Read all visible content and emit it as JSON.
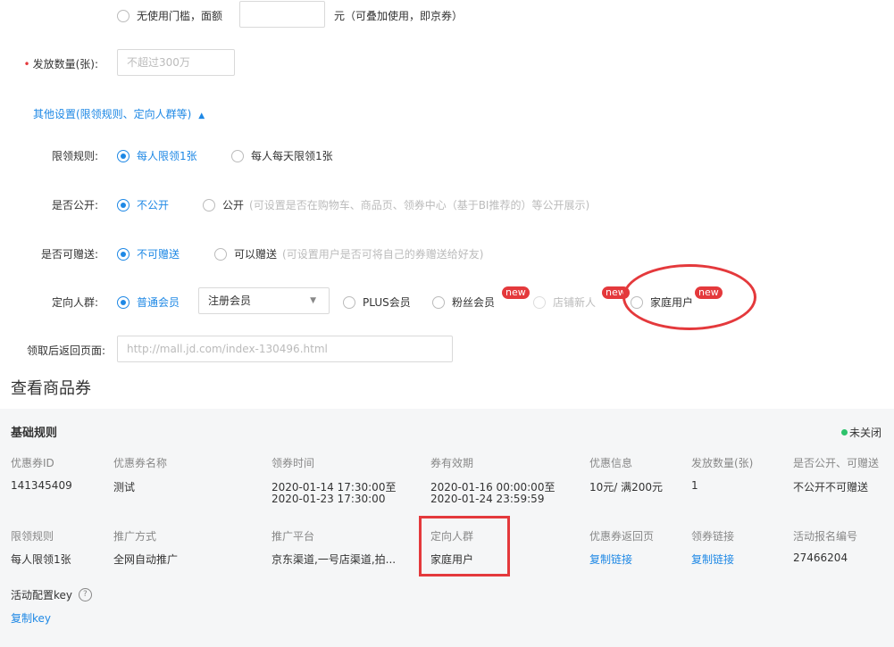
{
  "threshold": {
    "option_label": "无使用门槛，面额",
    "unit_text": "元（可叠加使用，即京券）"
  },
  "issue": {
    "label": "发放数量(张):",
    "placeholder": "不超过300万"
  },
  "other_settings": {
    "toggle_label": "其他设置(限领规则、定向人群等)",
    "toggle_icon": "caret-up-icon"
  },
  "limit_rule": {
    "label": "限领规则:",
    "options": [
      "每人限领1张",
      "每人每天限领1张"
    ]
  },
  "public": {
    "label": "是否公开:",
    "options": [
      "不公开",
      "公开"
    ],
    "hint": "(可设置是否在购物车、商品页、领券中心（基于BI推荐的）等公开展示)"
  },
  "gift": {
    "label": "是否可赠送:",
    "options": [
      "不可赠送",
      "可以赠送"
    ],
    "hint": "(可设置用户是否可将自己的券赠送给好友)"
  },
  "target": {
    "label": "定向人群:",
    "option_member": "普通会员",
    "select_value": "注册会员",
    "option_plus": "PLUS会员",
    "option_fans": "粉丝会员",
    "option_store_new": "店铺新人",
    "option_family": "家庭用户",
    "new_tag": "new"
  },
  "return_page": {
    "label": "领取后返回页面:",
    "placeholder": "http://mall.jd.com/index-130496.html"
  },
  "view_title": "查看商品券",
  "panel": {
    "title": "基础规则",
    "status": "未关闭",
    "status_color": "#2dc26b",
    "row1_headers": [
      "优惠券ID",
      "优惠券名称",
      "领券时间",
      "券有效期",
      "优惠信息",
      "发放数量(张)",
      "是否公开、可赠送"
    ],
    "row1_values": {
      "id": "141345409",
      "name": "测试",
      "get_time_1": "2020-01-14 17:30:00至",
      "get_time_2": "2020-01-23 17:30:00",
      "valid_1": "2020-01-16 00:00:00至",
      "valid_2": "2020-01-24 23:59:59",
      "discount": "10元/ 满200元",
      "quantity": "1",
      "public_gift": "不公开不可赠送"
    },
    "row2_headers": [
      "限领规则",
      "推广方式",
      "推广平台",
      "定向人群",
      "优惠券返回页",
      "领券链接",
      "活动报名编号"
    ],
    "row2_values": {
      "limit": "每人限领1张",
      "promo_method": "全网自动推广",
      "platform": "京东渠道,一号店渠道,拍...",
      "target": "家庭用户",
      "return_link": "复制链接",
      "coupon_link": "复制链接",
      "activity_no": "27466204"
    },
    "config_key_label": "活动配置key",
    "config_key_link": "复制key"
  }
}
